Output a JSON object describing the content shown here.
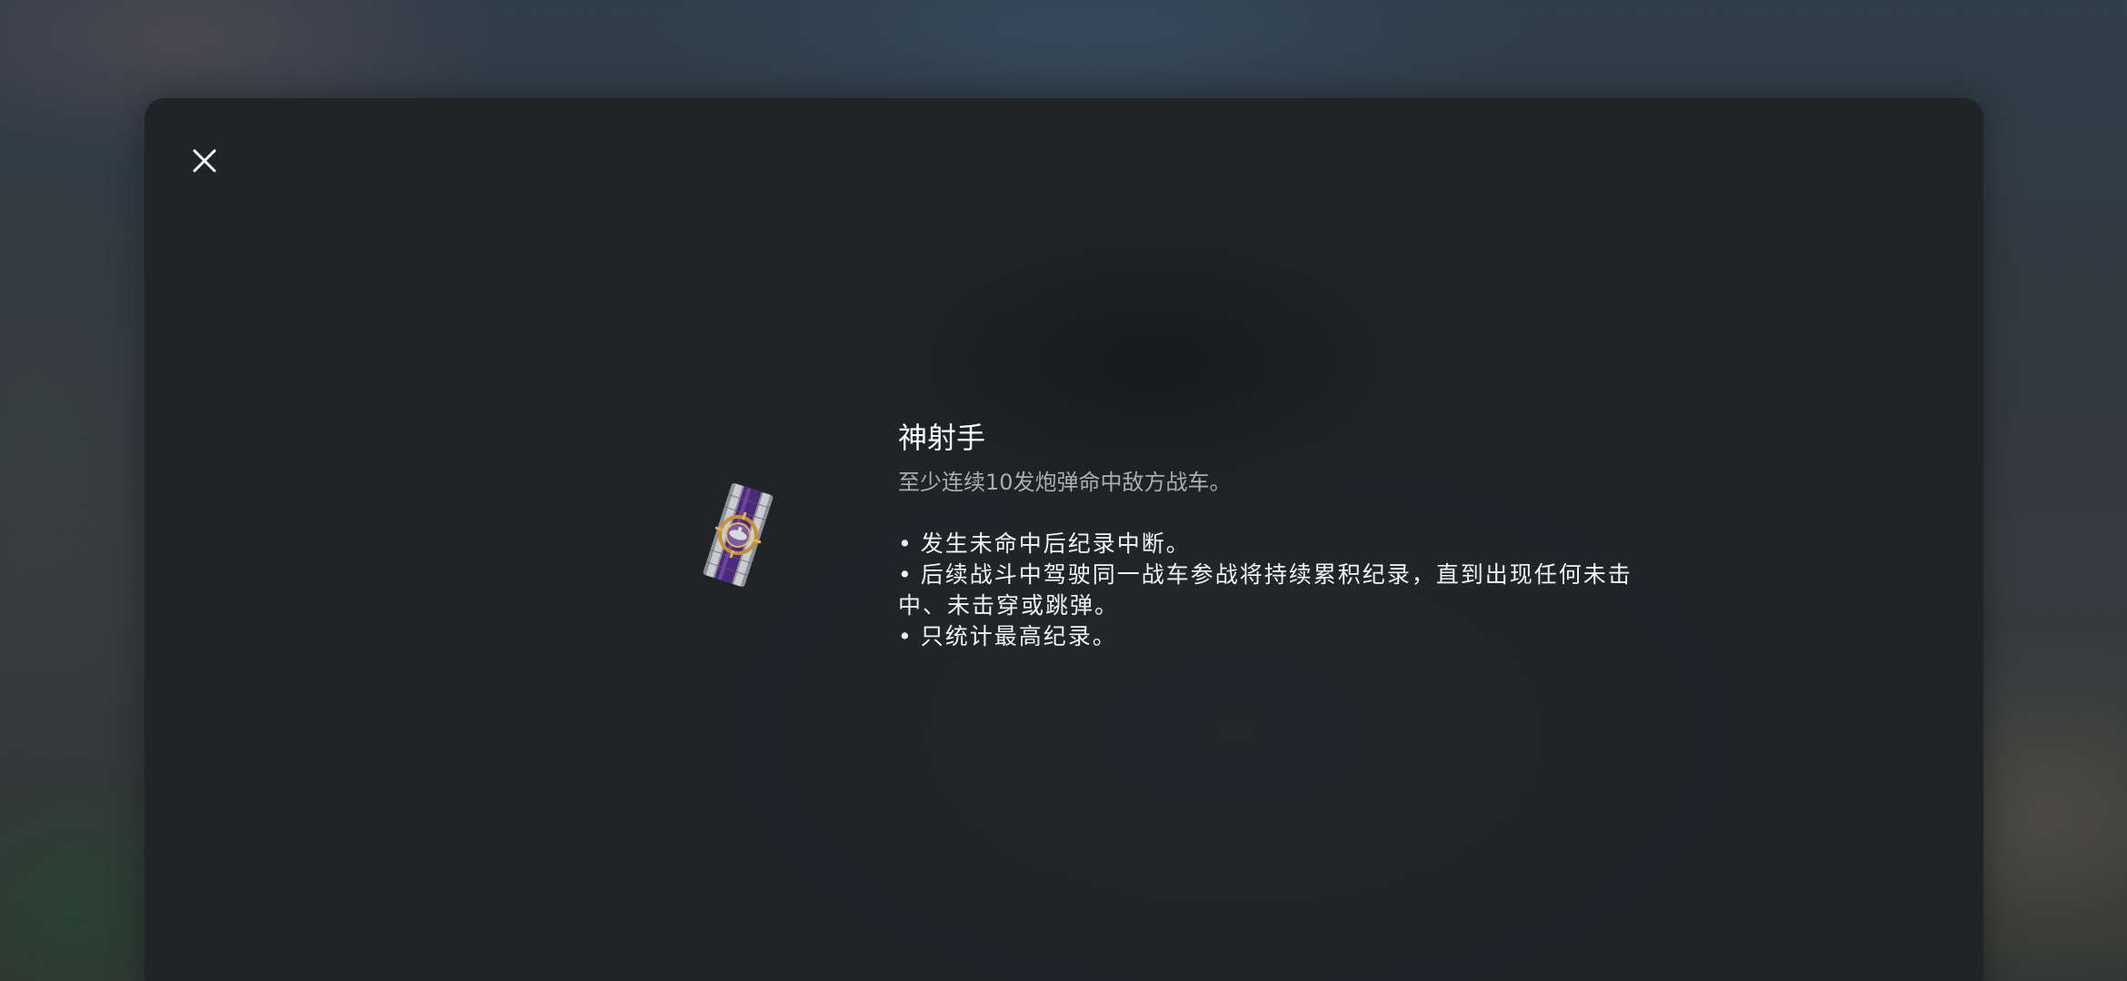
{
  "dialog": {
    "close_icon": "close-icon",
    "achievement": {
      "icon": "sharpshooter-medal-icon",
      "title": "神射手",
      "description": "至少连续10发炮弹命中敌方战车。",
      "rules": [
        "发生未命中后纪录中断。",
        "后续战斗中驾驶同一战车参战将持续累积纪录，直到出现任何未击中、未击穿或跳弹。",
        "只统计最高纪录。"
      ],
      "bullet": "•"
    }
  },
  "colors": {
    "panel_bg": "#202427",
    "title": "#ffffff",
    "subtitle": "#a9aeb2",
    "medal_purple": "#4b2a7a",
    "medal_gold": "#c9912e"
  }
}
